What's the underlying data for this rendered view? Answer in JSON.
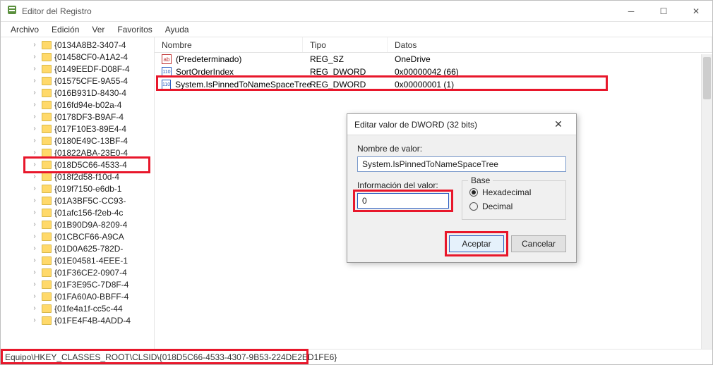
{
  "window": {
    "title": "Editor del Registro"
  },
  "menu": [
    "Archivo",
    "Edición",
    "Ver",
    "Favoritos",
    "Ayuda"
  ],
  "tree": [
    "{0134A8B2-3407-4",
    "{01458CF0-A1A2-4",
    "{0149EEDF-D08F-4",
    "{01575CFE-9A55-4",
    "{016B931D-8430-4",
    "{016fd94e-b02a-4",
    "{0178DF3-B9AF-4",
    "{017F10E3-89E4-4",
    "{0180E49C-13BF-4",
    "{01822ABA-23E0-4",
    "{018D5C66-4533-4",
    "{018f2d58-f10d-4",
    "{019f7150-e6db-1",
    "{01A3BF5C-CC93-",
    "{01afc156-f2eb-4c",
    "{01B90D9A-8209-4",
    "{01CBCF66-A9CA",
    "{01D0A625-782D-",
    "{01E04581-4EEE-1",
    "{01F36CE2-0907-4",
    "{01F3E95C-7D8F-4",
    "{01FA60A0-BBFF-4",
    "{01fe4a1f-cc5c-44",
    "{01FE4F4B-4ADD-4"
  ],
  "selectedIndex": 10,
  "columns": {
    "name": "Nombre",
    "type": "Tipo",
    "data": "Datos"
  },
  "rows": [
    {
      "icon": "ab",
      "name": "(Predeterminado)",
      "type": "REG_SZ",
      "data": "OneDrive"
    },
    {
      "icon": "bin",
      "name": "SortOrderIndex",
      "type": "REG_DWORD",
      "data": "0x00000042 (66)"
    },
    {
      "icon": "bin",
      "name": "System.IsPinnedToNameSpaceTree",
      "type": "REG_DWORD",
      "data": "0x00000001 (1)"
    }
  ],
  "highlightRow": 2,
  "status": "Equipo\\HKEY_CLASSES_ROOT\\CLSID\\{018D5C66-4533-4307-9B53-224DE2ED1FE6}",
  "dialog": {
    "title": "Editar valor de DWORD (32 bits)",
    "nameLabel": "Nombre de valor:",
    "nameValue": "System.IsPinnedToNameSpaceTree",
    "dataLabel": "Información del valor:",
    "dataValue": "0",
    "baseLabel": "Base",
    "hex": "Hexadecimal",
    "dec": "Decimal",
    "ok": "Aceptar",
    "cancel": "Cancelar"
  }
}
